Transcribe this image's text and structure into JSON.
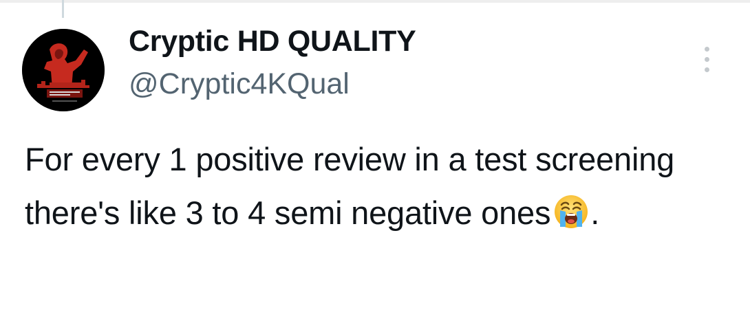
{
  "tweet": {
    "author": {
      "display_name": "Cryptic HD QUALITY",
      "handle": "@Cryptic4KQual",
      "avatar_icon": "red-figure-poster-avatar"
    },
    "text_main": "For every 1 positive review in a test screening there's like 3 to 4 semi negative ones",
    "emoji": "loudly-crying-face-emoji",
    "text_end": ".",
    "menu_icon": "more-options-icon"
  },
  "colors": {
    "text_primary": "#0f1419",
    "text_secondary": "#536471",
    "avatar_accent": "#c62a1f",
    "background": "#ffffff"
  }
}
